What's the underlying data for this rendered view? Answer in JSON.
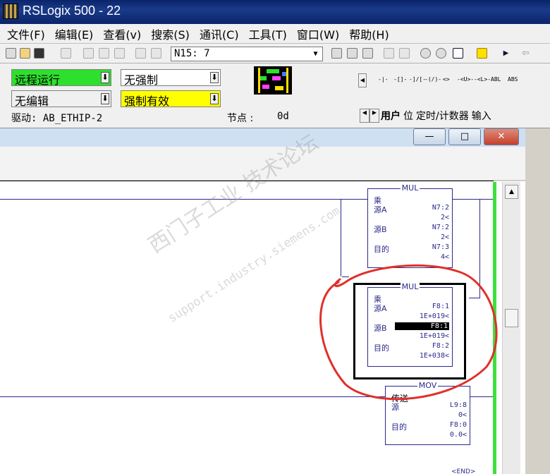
{
  "window": {
    "title": "RSLogix 500 - 22"
  },
  "menu": [
    "文件(F)",
    "编辑(E)",
    "查看(v)",
    "搜索(S)",
    "通讯(C)",
    "工具(T)",
    "窗口(W)",
    "帮助(H)"
  ],
  "toolbar": {
    "address_value": "N15: 7"
  },
  "status": {
    "mode": "远程运行",
    "edit": "无编辑",
    "forces": "无强制",
    "forces_enabled": "强制有效",
    "driver": "驱动: AB_ETHIP-2",
    "node_label": "节点 :",
    "node_value": "0d",
    "colors": {
      "mode_bg": "#2ee02e",
      "forces_enabled_bg": "#ffff00"
    }
  },
  "instructions": [
    "-|-",
    "-[]-",
    "-]/[-",
    "-(/)-",
    "<>",
    "-<U>-",
    "-<L>-",
    "ABL",
    "ABS"
  ],
  "tabs": [
    "用户",
    "位",
    "定时/计数器",
    "输入"
  ],
  "ladder": {
    "mul1": {
      "name": "MUL",
      "desc": "乘",
      "label_a": "源A",
      "a": "N7:2",
      "a_val": "2<",
      "label_b": "源B",
      "b": "N7:2",
      "b_val": "2<",
      "label_dest": "目的",
      "dest": "N7:3",
      "dest_val": "4<"
    },
    "mul2": {
      "name": "MUL",
      "desc": "乘",
      "label_a": "源A",
      "a": "F8:1",
      "a_val": "1E+019<",
      "label_b": "源B",
      "b": "F8:1",
      "b_val": "1E+019<",
      "label_dest": "目的",
      "dest": "F8:2",
      "dest_val": "1E+038<"
    },
    "mov": {
      "name": "MOV",
      "desc": "传送",
      "label_src": "源",
      "src": "L9:8",
      "src_val": "0<",
      "label_dest": "目的",
      "dest": "F8:0",
      "dest_val": "0.0<"
    },
    "end": "END"
  },
  "watermark": {
    "line1": "西门子工业 技术论坛",
    "line2": "support.industry.siemens.com"
  },
  "annotation_color": "#e0302a",
  "rail_color": "#3ee03e"
}
